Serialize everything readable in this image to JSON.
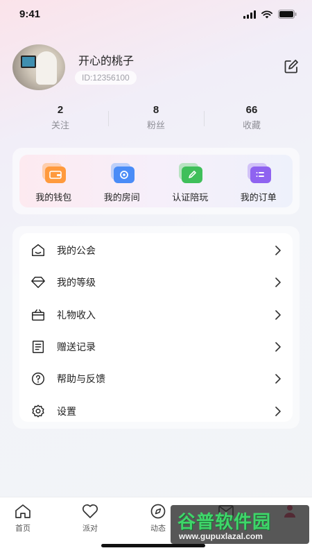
{
  "status_bar": {
    "time": "9:41"
  },
  "profile": {
    "nickname": "开心的桃子",
    "user_id": "ID:12356100"
  },
  "stats": [
    {
      "value": "2",
      "label": "关注"
    },
    {
      "value": "8",
      "label": "粉丝"
    },
    {
      "value": "66",
      "label": "收藏"
    }
  ],
  "quick_actions": [
    {
      "label": "我的钱包",
      "icon": "wallet-icon",
      "color": "#ff9a3d"
    },
    {
      "label": "我的房间",
      "icon": "room-icon",
      "color": "#4a8cf7"
    },
    {
      "label": "认证陪玩",
      "icon": "certify-icon",
      "color": "#3fbf5a"
    },
    {
      "label": "我的订单",
      "icon": "order-icon",
      "color": "#8f63f0"
    }
  ],
  "menu": [
    {
      "label": "我的公会",
      "icon": "guild-icon"
    },
    {
      "label": "我的等级",
      "icon": "level-icon"
    },
    {
      "label": "礼物收入",
      "icon": "gift-income-icon"
    },
    {
      "label": "赠送记录",
      "icon": "gift-record-icon"
    },
    {
      "label": "帮助与反馈",
      "icon": "help-icon"
    },
    {
      "label": "设置",
      "icon": "settings-icon"
    }
  ],
  "tabbar": [
    {
      "label": "首页",
      "icon": "home-icon"
    },
    {
      "label": "派对",
      "icon": "heart-icon"
    },
    {
      "label": "动态",
      "icon": "compass-icon"
    },
    {
      "label": "",
      "icon": "message-icon"
    },
    {
      "label": "",
      "icon": "profile-icon"
    }
  ],
  "watermark": {
    "title": "谷普软件园",
    "url": "www.gupuxlazal.com"
  }
}
